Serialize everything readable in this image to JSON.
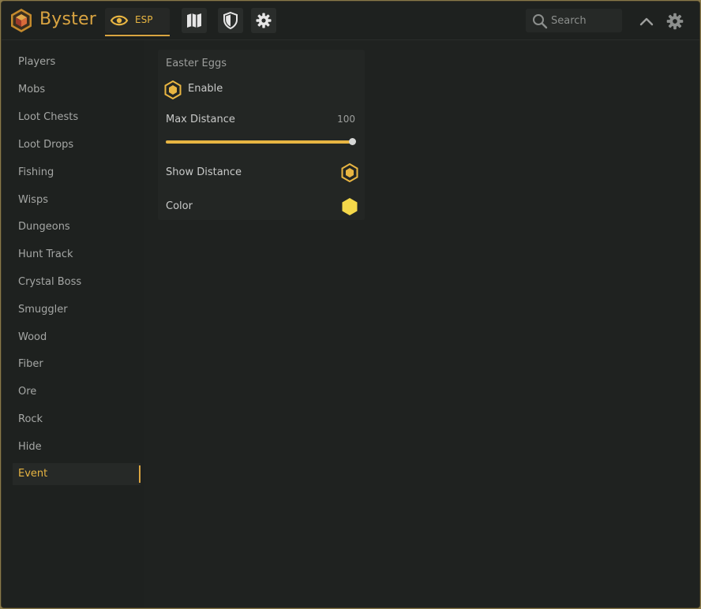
{
  "app": {
    "brand": "Byster"
  },
  "tabs": {
    "esp_label": "ESP"
  },
  "search": {
    "placeholder": "Search",
    "value": ""
  },
  "sidebar": {
    "items": [
      {
        "label": "Players"
      },
      {
        "label": "Mobs"
      },
      {
        "label": "Loot Chests"
      },
      {
        "label": "Loot Drops"
      },
      {
        "label": "Fishing"
      },
      {
        "label": "Wisps"
      },
      {
        "label": "Dungeons"
      },
      {
        "label": "Hunt Track"
      },
      {
        "label": "Crystal Boss"
      },
      {
        "label": "Smuggler"
      },
      {
        "label": "Wood"
      },
      {
        "label": "Fiber"
      },
      {
        "label": "Ore"
      },
      {
        "label": "Rock"
      },
      {
        "label": "Hide"
      },
      {
        "label": "Event"
      }
    ],
    "active": "Event"
  },
  "panel": {
    "title": "Easter Eggs",
    "enable_label": "Enable",
    "max_distance_label": "Max Distance",
    "max_distance_value": "100",
    "max_distance_fraction": 1.0,
    "show_distance_label": "Show Distance",
    "color_label": "Color",
    "color_value": "#f4d84a"
  },
  "colors": {
    "accent": "#e8b542",
    "background": "#1f2220"
  },
  "icons": {
    "logo": "byster-logo-icon",
    "esp": "eye-icon",
    "map": "map-icon",
    "shield": "shield-icon",
    "settings": "gear-icon",
    "search": "search-icon",
    "collapse": "chevron-up-icon",
    "enable": "hexagon-toggle-icon"
  }
}
